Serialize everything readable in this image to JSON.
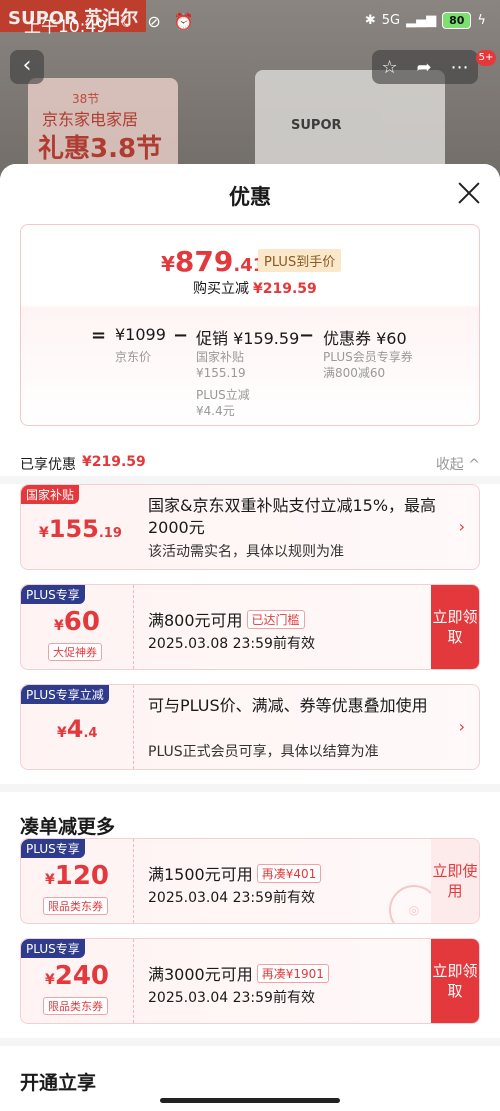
{
  "status": {
    "time": "上午10:49",
    "left_icons": "☾ ⊘ ⏰",
    "network": "5G",
    "battery": "80"
  },
  "background": {
    "brand": "SUPOR 苏泊尔",
    "poster_line1": "38节",
    "poster_line2": "京东家电家居",
    "poster_line3": "礼惠3.8节",
    "device_brand": "SUPOR",
    "badge": "5+"
  },
  "sheet": {
    "title": "优惠"
  },
  "price_card": {
    "currency": "¥",
    "price_int": "879",
    "price_dec": ".41",
    "plus_tag": "PLUS到手价",
    "buy_reduce_label": "购买立减",
    "buy_reduce_amount": "¥219.59",
    "formula": {
      "eq": "=",
      "base_value": "¥1099",
      "base_label": "京东价",
      "minus1": "−",
      "promo_value": "促销 ¥159.59",
      "promo_sub1_label": "国家补贴",
      "promo_sub1_value": "¥155.19",
      "promo_sub2_label": "PLUS立减",
      "promo_sub2_value": "¥4.4元",
      "minus2": "−",
      "coupon_value": "优惠券 ¥60",
      "coupon_sub1": "PLUS会员专享券",
      "coupon_sub2": "满800减60"
    }
  },
  "enjoyed": {
    "label": "已享优惠",
    "amount": "¥219.59",
    "collapse": "收起 ^"
  },
  "deals": [
    {
      "tag": "国家补贴",
      "currency": "¥",
      "int": "155",
      "dec": ".19",
      "title": "国家&京东双重补贴支付立减15%，最高2000元",
      "desc": "该活动需实名，具体以规则为准"
    },
    {
      "tag": "PLUS专享",
      "currency": "¥",
      "int": "60",
      "chip": "大促神券",
      "title": "满800元可用",
      "title_chip": "已达门槛",
      "date": "2025.03.08 23:59前有效",
      "action": "立即领取"
    },
    {
      "tag": "PLUS专享立减",
      "currency": "¥",
      "int": "4",
      "dec": ".4",
      "title": "可与PLUS价、满减、券等优惠叠加使用",
      "desc": "PLUS正式会员可享，具体以结算为准"
    }
  ],
  "more": {
    "title": "凑单减更多",
    "coupons": [
      {
        "tag": "PLUS专享",
        "currency": "¥",
        "int": "120",
        "chip": "限品类东券",
        "title": "满1500元可用",
        "title_chip": "再凑¥401",
        "date": "2025.03.04 23:59前有效",
        "action": "立即使用"
      },
      {
        "tag": "PLUS专享",
        "currency": "¥",
        "int": "240",
        "chip": "限品类东券",
        "title": "满3000元可用",
        "title_chip": "再凑¥1901",
        "date": "2025.03.04 23:59前有效",
        "action": "立即领取"
      }
    ]
  },
  "open": {
    "title": "开通立享"
  }
}
